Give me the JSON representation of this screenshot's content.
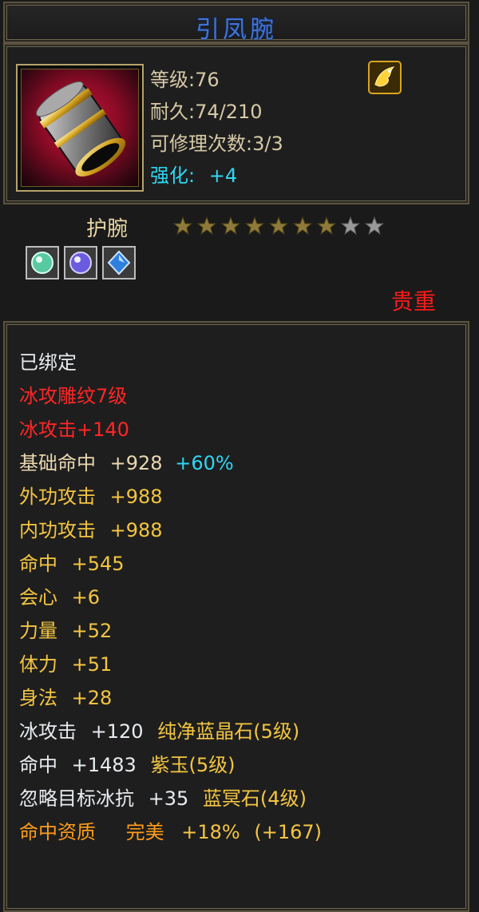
{
  "item": {
    "name": "引凤腕",
    "level_text": "等级:76",
    "durability_text": "耐久:74/210",
    "repair_text": "可修理次数:3/3",
    "enhance_label": "强化:",
    "enhance_value": "+4",
    "type": "护腕",
    "rarity": "贵重",
    "stars_total": 9,
    "stars_filled": 7
  },
  "colors": {
    "title": "#3f74d8",
    "rarity": "#ff1a1a",
    "star_filled": "#8f7a3a",
    "star_empty": "#9a9a9a"
  },
  "icons": {
    "item": "bracer-icon",
    "badge": "dragon-badge-icon",
    "gems": [
      "green-gem-icon",
      "purple-gem-icon",
      "blue-gem-icon"
    ]
  },
  "props": {
    "bound": "已绑定",
    "engrave": "冰攻雕纹7级",
    "ice_attack": "冰攻击+140",
    "base_hit_label": "基础命中",
    "base_hit_value": "+928",
    "base_hit_pct": "+60%",
    "outer_attack": "外功攻击",
    "outer_attack_val": "+988",
    "inner_attack": "内功攻击",
    "inner_attack_val": "+988",
    "hit": "命中",
    "hit_val": "+545",
    "crit": "会心",
    "crit_val": "+6",
    "strength": "力量",
    "strength_val": "+52",
    "stamina": "体力",
    "stamina_val": "+51",
    "agility": "身法",
    "agility_val": "+28",
    "gem1_attr": "冰攻击",
    "gem1_val": "+120",
    "gem1_name": "纯净蓝晶石(5级)",
    "gem2_attr": "命中",
    "gem2_val": "+1483",
    "gem2_name": "紫玉(5级)",
    "gem3_attr": "忽略目标冰抗",
    "gem3_val": "+35",
    "gem3_name": "蓝冥石(4级)",
    "aptitude_label": "命中资质",
    "aptitude_grade": "完美",
    "aptitude_pct": "+18%",
    "aptitude_bonus": "(+167)"
  }
}
